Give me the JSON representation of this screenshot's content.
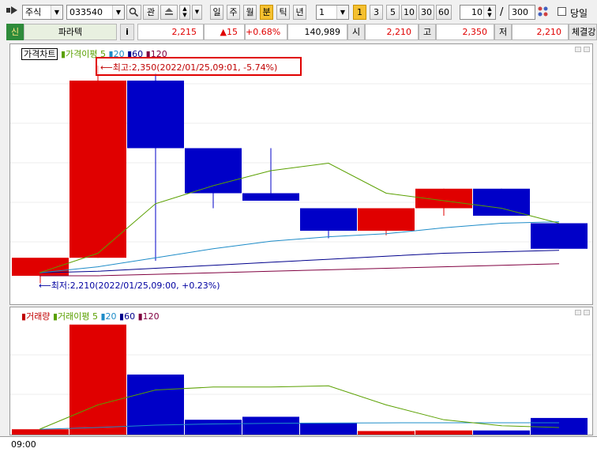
{
  "toolbar": {
    "market_label": "주식",
    "code_value": "033540",
    "watch_label": "관",
    "periods": [
      "일",
      "주",
      "월",
      "분",
      "틱",
      "년"
    ],
    "active_period": "분",
    "interval_value": "1",
    "minute_options": [
      "1",
      "3",
      "5",
      "10",
      "30",
      "60"
    ],
    "count_value": "10",
    "slash": "/",
    "total_value": "300",
    "today_label": "당일"
  },
  "quote": {
    "badge": "신",
    "name": "파라텍",
    "info_label": "i",
    "price": "2,215",
    "change": "▲15",
    "change_pct": "+0.68%",
    "volume": "140,989",
    "open_label": "시",
    "open": "2,210",
    "high_label": "고",
    "high": "2,350",
    "low_label": "저",
    "low": "2,210",
    "extra_label": "체결강"
  },
  "price_panel": {
    "legend": [
      "가격차트",
      "가격이평 5",
      "20",
      "60",
      "120"
    ],
    "high_annotation": "최고:2,350(2022/01/25,09:01, -5.74%)",
    "low_annotation": "최저:2,210(2022/01/25,09:00, +0.23%)"
  },
  "volume_panel": {
    "legend": [
      "거래량",
      "거래이평 5",
      "20",
      "60",
      "120"
    ]
  },
  "time_axis": {
    "start": "09:00"
  },
  "colors": {
    "up": "#e00000",
    "down": "#0000c8",
    "ma5": "#5aa000",
    "ma20": "#1e8cc8",
    "ma60": "#00008c",
    "ma120": "#800040"
  },
  "chart_data": {
    "type": "candlestick",
    "candles": [
      {
        "open": 2210,
        "high": 2210,
        "low": 2205,
        "close": 2222
      },
      {
        "open": 2222,
        "high": 2350,
        "low": 2222,
        "close": 2340
      },
      {
        "open": 2340,
        "high": 2345,
        "low": 2220,
        "close": 2295
      },
      {
        "open": 2295,
        "high": 2295,
        "low": 2255,
        "close": 2265
      },
      {
        "open": 2265,
        "high": 2295,
        "low": 2265,
        "close": 2260
      },
      {
        "open": 2255,
        "high": 2255,
        "low": 2235,
        "close": 2240
      },
      {
        "open": 2240,
        "high": 2255,
        "low": 2237,
        "close": 2255
      },
      {
        "open": 2255,
        "high": 2268,
        "low": 2250,
        "close": 2268
      },
      {
        "open": 2268,
        "high": 2268,
        "low": 2250,
        "close": 2250
      },
      {
        "open": 2245,
        "high": 2245,
        "low": 2228,
        "close": 2228
      }
    ],
    "ma5": [
      2212,
      2225,
      2258,
      2270,
      2280,
      2285,
      2265,
      2260,
      2255,
      2245
    ],
    "ma20": [
      2212,
      2216,
      2222,
      2228,
      2233,
      2236,
      2238,
      2242,
      2245,
      2246
    ],
    "ma60": [
      2212,
      2213,
      2215,
      2217,
      2219,
      2221,
      2223,
      2225,
      2226,
      2227
    ],
    "ma120": [
      2210,
      2210,
      2211,
      2212,
      2213,
      2214,
      2215,
      2216,
      2217,
      2218
    ],
    "price_range": [
      2200,
      2360
    ],
    "volumes": [
      9000,
      185000,
      101000,
      25000,
      30000,
      20000,
      6000,
      7000,
      7000,
      28000
    ],
    "vol_ma5": [
      9000,
      50000,
      75000,
      80000,
      80000,
      82000,
      50000,
      25000,
      15000,
      12000
    ],
    "vol_ma20": [
      9000,
      12000,
      16000,
      18000,
      19000,
      19500,
      19800,
      20000,
      20000,
      20000
    ],
    "vol_range": [
      0,
      190000
    ]
  }
}
